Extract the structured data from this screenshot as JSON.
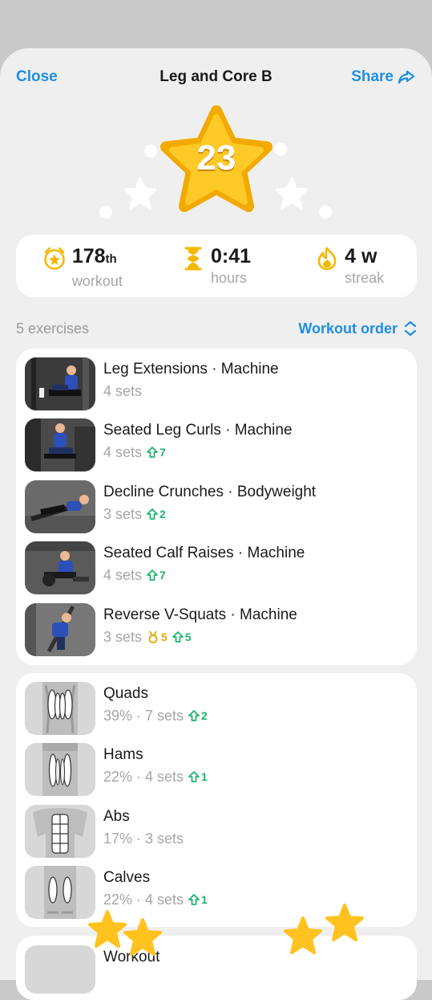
{
  "header": {
    "close": "Close",
    "title": "Leg and Core B",
    "share": "Share"
  },
  "hero": {
    "stars": "23"
  },
  "stats": [
    {
      "value": "178",
      "suffix": "th",
      "label": "workout",
      "icon": "medal-star-icon"
    },
    {
      "value": "0:41",
      "suffix": "",
      "label": "hours",
      "icon": "hourglass-icon"
    },
    {
      "value": "4 w",
      "suffix": "",
      "label": "streak",
      "icon": "flame-icon"
    }
  ],
  "section": {
    "count": "5 exercises",
    "order": "Workout order"
  },
  "exercises": [
    {
      "name": "Leg Extensions · Machine",
      "sets": "4 sets",
      "medal": "",
      "increase": ""
    },
    {
      "name": "Seated Leg Curls · Machine",
      "sets": "4 sets",
      "medal": "",
      "increase": "7"
    },
    {
      "name": "Decline Crunches · Bodyweight",
      "sets": "3 sets",
      "medal": "",
      "increase": "2"
    },
    {
      "name": "Seated Calf Raises · Machine",
      "sets": "4 sets",
      "medal": "",
      "increase": "7"
    },
    {
      "name": "Reverse V-Squats · Machine",
      "sets": "3 sets",
      "medal": "5",
      "increase": "5"
    }
  ],
  "muscles": [
    {
      "name": "Quads",
      "detail": "39% · 7 sets",
      "increase": "2"
    },
    {
      "name": "Hams",
      "detail": "22% · 4 sets",
      "increase": "1"
    },
    {
      "name": "Abs",
      "detail": "17% · 3 sets",
      "increase": ""
    },
    {
      "name": "Calves",
      "detail": "22% · 4 sets",
      "increase": "1"
    }
  ],
  "bottom": {
    "label": "Workout"
  },
  "colors": {
    "accent": "#1e8fe1",
    "gold": "#f5b800",
    "increase": "#1bb56f"
  }
}
